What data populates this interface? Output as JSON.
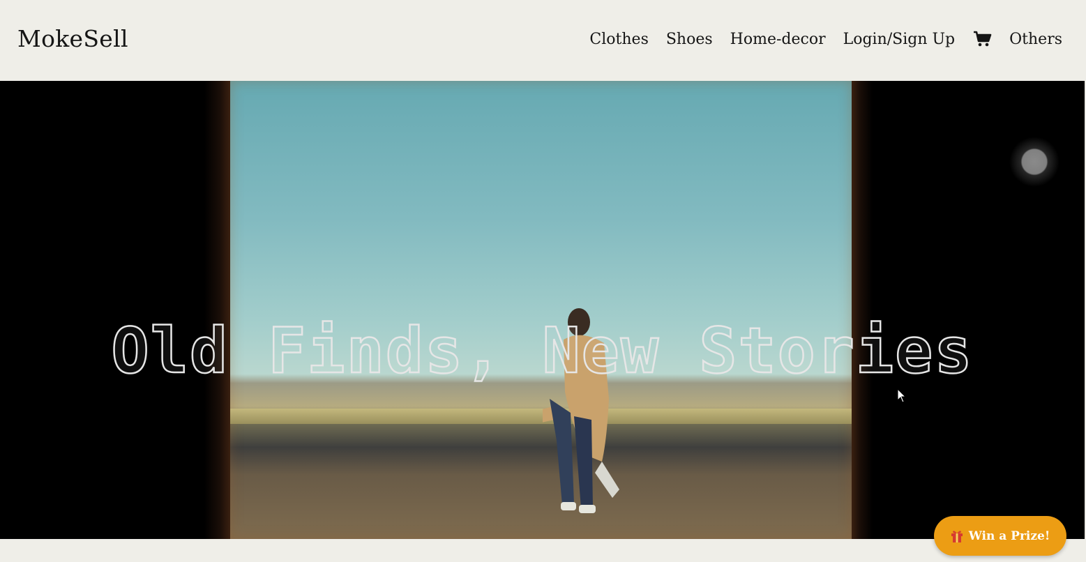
{
  "header": {
    "brand": "MokeSell",
    "nav": {
      "clothes": "Clothes",
      "shoes": "Shoes",
      "home_decor": "Home-decor",
      "login": "Login/Sign Up",
      "cart_icon": "cart-icon",
      "others": "Others"
    }
  },
  "hero": {
    "title": "Old Finds, New Stories",
    "carousel_indicator_icon": "carousel-dot"
  },
  "prize_button": {
    "label": "Win a Prize!",
    "icon": "gift-icon",
    "color": "#ec9d14"
  },
  "colors": {
    "background": "#efeee8",
    "text": "#151515"
  }
}
